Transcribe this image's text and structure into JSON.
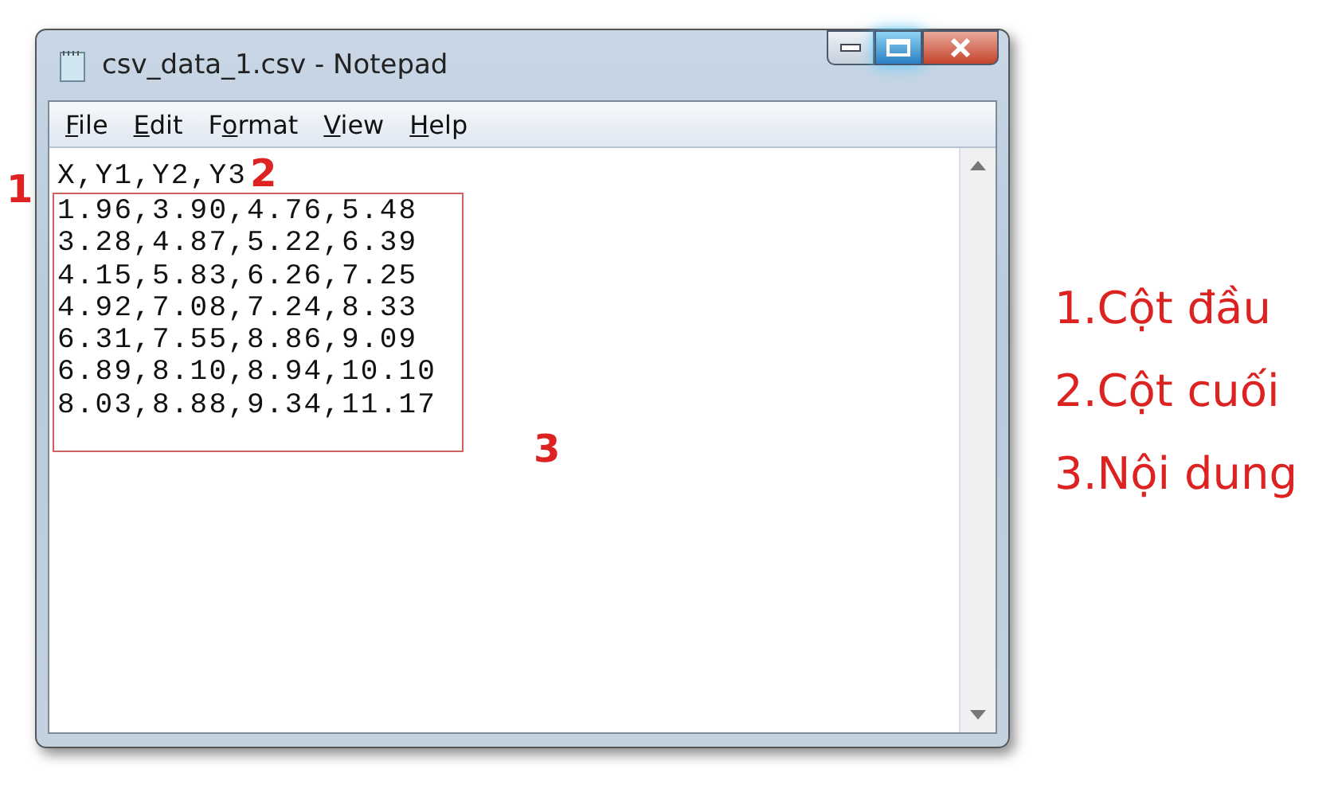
{
  "window": {
    "title": "csv_data_1.csv - Notepad"
  },
  "menu": [
    {
      "key": "F",
      "post": "ile"
    },
    {
      "key": "E",
      "post": "dit"
    },
    {
      "pre": "F",
      "key": "o",
      "post": "rmat"
    },
    {
      "key": "V",
      "post": "iew"
    },
    {
      "key": "H",
      "post": "elp"
    }
  ],
  "editor": {
    "header_line": "X,Y1,Y2,Y3",
    "data_lines": [
      "1.96,3.90,4.76,5.48",
      "3.28,4.87,5.22,6.39",
      "4.15,5.83,6.26,7.25",
      "4.92,7.08,7.24,8.33",
      "6.31,7.55,8.86,9.09",
      "6.89,8.10,8.94,10.10",
      "8.03,8.88,9.34,11.17"
    ]
  },
  "annotations": {
    "marks": [
      "1",
      "2",
      "3"
    ],
    "legend": [
      "1.Cột đầu",
      "2.Cột cuối",
      "3.Nội dung"
    ]
  }
}
